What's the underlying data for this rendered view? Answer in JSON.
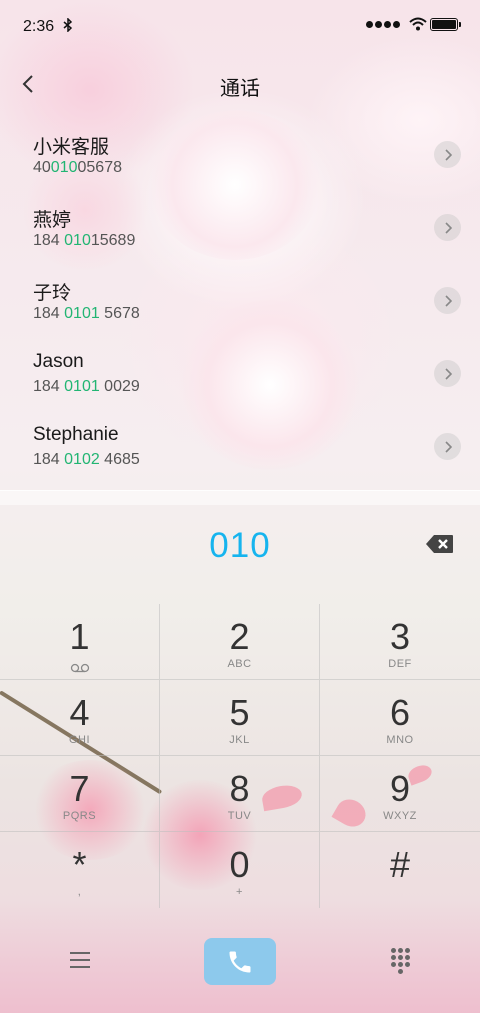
{
  "status_bar": {
    "time": "2:36",
    "bluetooth_icon": "bluetooth-icon",
    "signal_icon": "signal-dots-icon",
    "wifi_icon": "wifi-icon",
    "battery_icon": "battery-icon"
  },
  "header": {
    "title": "通话",
    "back_icon": "chevron-left-icon"
  },
  "contacts": [
    {
      "name": "小米客服",
      "number_pre": "40",
      "number_match": "010",
      "number_post": "05678"
    },
    {
      "name": "燕婷",
      "number_pre": "184 ",
      "number_match": "010",
      "number_post": "15689"
    },
    {
      "name": "子玲",
      "number_pre": "184 ",
      "number_match": "0101",
      "number_post": " 5678"
    },
    {
      "name": "Jason",
      "number_pre": "184 ",
      "number_match": "0101",
      "number_post": " 0029"
    },
    {
      "name": "Stephanie",
      "number_pre": "184 ",
      "number_match": "0102",
      "number_post": " 4685"
    }
  ],
  "dialer": {
    "input": "010",
    "delete_icon": "backspace-icon"
  },
  "keypad": [
    {
      "digit": "1",
      "letters": ""
    },
    {
      "digit": "2",
      "letters": "ABC"
    },
    {
      "digit": "3",
      "letters": "DEF"
    },
    {
      "digit": "4",
      "letters": "GHI"
    },
    {
      "digit": "5",
      "letters": "JKL"
    },
    {
      "digit": "6",
      "letters": "MNO"
    },
    {
      "digit": "7",
      "letters": "PQRS"
    },
    {
      "digit": "8",
      "letters": "TUV"
    },
    {
      "digit": "9",
      "letters": "WXYZ"
    },
    {
      "digit": "*",
      "letters": ","
    },
    {
      "digit": "0",
      "letters": "+"
    },
    {
      "digit": "#",
      "letters": ""
    }
  ],
  "bottom_bar": {
    "menu_icon": "menu-icon",
    "call_icon": "phone-icon",
    "keypad_icon": "dialpad-icon"
  },
  "colors": {
    "match_highlight": "#22b573",
    "dial_input": "#16b4ee",
    "call_button": "#8dc9ec"
  }
}
